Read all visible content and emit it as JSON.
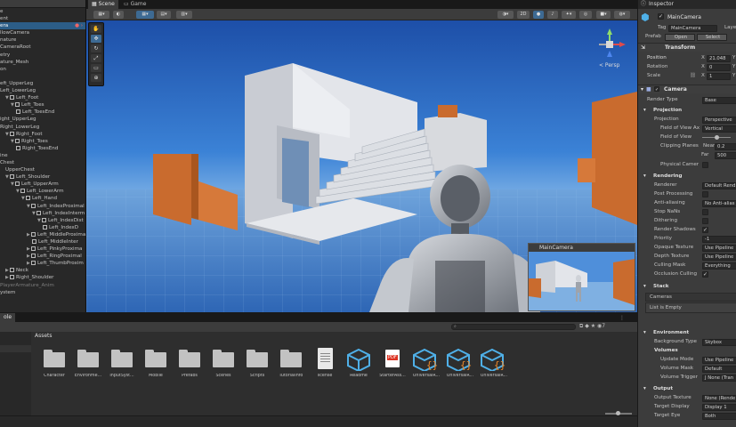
{
  "hierarchy": {
    "rows": [
      {
        "label": "e",
        "indent": 0,
        "style": "",
        "icon": false,
        "tri": ""
      },
      {
        "label": "ent",
        "indent": 0,
        "style": "",
        "icon": false,
        "tri": ""
      },
      {
        "label": "era",
        "indent": 0,
        "style": "sel",
        "icon": false,
        "tri": ""
      },
      {
        "label": "llowCamera",
        "indent": 0,
        "style": "",
        "icon": false,
        "tri": ""
      },
      {
        "label": "nature",
        "indent": 0,
        "style": "",
        "icon": false,
        "tri": ""
      },
      {
        "label": "CameraRoot",
        "indent": 0,
        "style": "",
        "icon": false,
        "tri": ""
      },
      {
        "label": "etry",
        "indent": 0,
        "style": "",
        "icon": false,
        "tri": ""
      },
      {
        "label": "ature_Mesh",
        "indent": 0,
        "style": "",
        "icon": false,
        "tri": ""
      },
      {
        "label": "on",
        "indent": 0,
        "style": "",
        "icon": false,
        "tri": ""
      },
      {
        "label": "",
        "indent": 0,
        "style": "",
        "icon": false,
        "tri": ""
      },
      {
        "label": "eft_UpperLeg",
        "indent": 0,
        "style": "",
        "icon": false,
        "tri": ""
      },
      {
        "label": "Left_LowerLeg",
        "indent": 0,
        "style": "",
        "icon": false,
        "tri": ""
      },
      {
        "label": "Left_Foot",
        "indent": 1,
        "style": "",
        "icon": true,
        "tri": "▼"
      },
      {
        "label": "Left_Toes",
        "indent": 2,
        "style": "",
        "icon": true,
        "tri": "▼"
      },
      {
        "label": "Left_ToesEnd",
        "indent": 3,
        "style": "",
        "icon": true,
        "tri": ""
      },
      {
        "label": "ight_UpperLeg",
        "indent": 0,
        "style": "",
        "icon": false,
        "tri": ""
      },
      {
        "label": "Right_LowerLeg",
        "indent": 0,
        "style": "",
        "icon": false,
        "tri": ""
      },
      {
        "label": "Right_Foot",
        "indent": 1,
        "style": "",
        "icon": true,
        "tri": "▼"
      },
      {
        "label": "Right_Toes",
        "indent": 2,
        "style": "",
        "icon": true,
        "tri": "▼"
      },
      {
        "label": "Right_ToesEnd",
        "indent": 3,
        "style": "",
        "icon": true,
        "tri": ""
      },
      {
        "label": "ine",
        "indent": 0,
        "style": "",
        "icon": false,
        "tri": ""
      },
      {
        "label": "Chest",
        "indent": 0,
        "style": "",
        "icon": false,
        "tri": ""
      },
      {
        "label": "UpperChest",
        "indent": 1,
        "style": "",
        "icon": false,
        "tri": ""
      },
      {
        "label": "Left_Shoulder",
        "indent": 1,
        "style": "",
        "icon": true,
        "tri": "▼"
      },
      {
        "label": "Left_UpperArm",
        "indent": 2,
        "style": "",
        "icon": true,
        "tri": "▼"
      },
      {
        "label": "Left_LowerArm",
        "indent": 3,
        "style": "",
        "icon": true,
        "tri": "▼"
      },
      {
        "label": "Left_Hand",
        "indent": 4,
        "style": "",
        "icon": true,
        "tri": "▼"
      },
      {
        "label": "Left_IndexProximal",
        "indent": 5,
        "style": "",
        "icon": true,
        "tri": "▼"
      },
      {
        "label": "Left_IndexInterm",
        "indent": 6,
        "style": "",
        "icon": true,
        "tri": "▼"
      },
      {
        "label": "Left_IndexDist",
        "indent": 7,
        "style": "",
        "icon": true,
        "tri": "▼"
      },
      {
        "label": "Left_IndexD",
        "indent": 8,
        "style": "",
        "icon": true,
        "tri": ""
      },
      {
        "label": "Left_MiddleProxima",
        "indent": 5,
        "style": "",
        "icon": true,
        "tri": "▶"
      },
      {
        "label": "Left_MiddleInter",
        "indent": 6,
        "style": "",
        "icon": true,
        "tri": ""
      },
      {
        "label": "Left_PinkyProxima",
        "indent": 5,
        "style": "",
        "icon": true,
        "tri": "▶"
      },
      {
        "label": "Left_RingProximal",
        "indent": 5,
        "style": "",
        "icon": true,
        "tri": "▶"
      },
      {
        "label": "Left_ThumbProxim",
        "indent": 5,
        "style": "",
        "icon": true,
        "tri": "▶"
      },
      {
        "label": "Neck",
        "indent": 1,
        "style": "",
        "icon": true,
        "tri": "▶"
      },
      {
        "label": "Right_Shoulder",
        "indent": 1,
        "style": "",
        "icon": true,
        "tri": "▶"
      },
      {
        "label": "PlayerArmature_Anim",
        "indent": 0,
        "style": "dim",
        "icon": false,
        "tri": ""
      },
      {
        "label": "ystem",
        "indent": 0,
        "style": "",
        "icon": false,
        "tri": ""
      }
    ]
  },
  "scene": {
    "tab_scene": "Scene",
    "tab_game": "Game",
    "toolbar_2d": "2D",
    "persp_label": "< Persp",
    "preview_title": "MainCamera"
  },
  "project": {
    "tab": "ole",
    "breadcrumb": "Assets",
    "assets": [
      {
        "name": "Character",
        "kind": "folder"
      },
      {
        "name": "Environme...",
        "kind": "folder"
      },
      {
        "name": "InputSyst...",
        "kind": "folder"
      },
      {
        "name": "Mobile",
        "kind": "folder"
      },
      {
        "name": "Prefabs",
        "kind": "folder"
      },
      {
        "name": "Scenes",
        "kind": "folder"
      },
      {
        "name": "Scripts",
        "kind": "folder"
      },
      {
        "name": "TutorialInfo",
        "kind": "folder"
      },
      {
        "name": "license",
        "kind": "doc"
      },
      {
        "name": "Readme",
        "kind": "cube"
      },
      {
        "name": "StarterAss...",
        "kind": "pdf"
      },
      {
        "name": "UniversalR...",
        "kind": "cubescript"
      },
      {
        "name": "UniversalR...",
        "kind": "cubescript"
      },
      {
        "name": "UniversalR...",
        "kind": "cubescript"
      }
    ],
    "pdf_text": "PDF"
  },
  "inspector": {
    "tab": "Inspector",
    "object_name": "MainCamera",
    "tag_label": "Tag",
    "tag_value": "MainCamera",
    "layer_label": "Laye",
    "prefab_label": "Prefab",
    "open_label": "Open",
    "select_label": "Select",
    "transform_title": "Transform",
    "position_label": "Position",
    "rotation_label": "Rotation",
    "scale_label": "Scale",
    "x": "X",
    "y": "Y",
    "pos_x": "21.048",
    "rot_x": "0",
    "scale_x": "1",
    "camera_title": "Camera",
    "render_type_label": "Render Type",
    "render_type_value": "Base",
    "projection_title": "Projection",
    "projection_label": "Projection",
    "projection_value": "Perspective",
    "fov_axis_label": "Field of View Ax",
    "fov_axis_value": "Vertical",
    "fov_label": "Field of View",
    "clipping_label": "Clipping Planes",
    "near_label": "Near",
    "near_value": "0.2",
    "far_label": "Far",
    "far_value": "500",
    "physical_label": "Physical Camer",
    "rendering_title": "Rendering",
    "renderer_label": "Renderer",
    "renderer_value": "Default Rend",
    "postproc_label": "Post Processing",
    "antialias_label": "Anti-aliasing",
    "antialias_value": "No Anti-alias",
    "stopnans_label": "Stop NaNs",
    "dither_label": "Dithering",
    "shadows_label": "Render Shadows",
    "priority_label": "Priority",
    "priority_value": "-1",
    "opaque_label": "Opaque Texture",
    "opaque_value": "Use Pipeline",
    "depth_label": "Depth Texture",
    "depth_value": "Use Pipeline",
    "culling_label": "Culling Mask",
    "culling_value": "Everything",
    "occlusion_label": "Occlusion Culling",
    "stack_title": "Stack",
    "cameras_label": "Cameras",
    "list_empty": "List is Empty",
    "environment_title": "Environment",
    "bgtype_label": "Background Type",
    "bgtype_value": "Skybox",
    "volumes_label": "Volumes",
    "update_label": "Update Mode",
    "update_value": "Use Pipeline",
    "vmask_label": "Volume Mask",
    "vmask_value": "Default",
    "vtrigger_label": "Volume Trigger",
    "vtrigger_value": "J None (Tran",
    "output_title": "Output",
    "outtex_label": "Output Texture",
    "outtex_value": "None (Rende",
    "tdisplay_label": "Target Display",
    "tdisplay_value": "Display 1",
    "teye_label": "Target Eye",
    "teye_value": "Both"
  },
  "colors": {
    "selection": "#2c5d87",
    "accent": "#3d6a93",
    "crate": "#c96b2e",
    "sky": "#2f6fc8"
  }
}
